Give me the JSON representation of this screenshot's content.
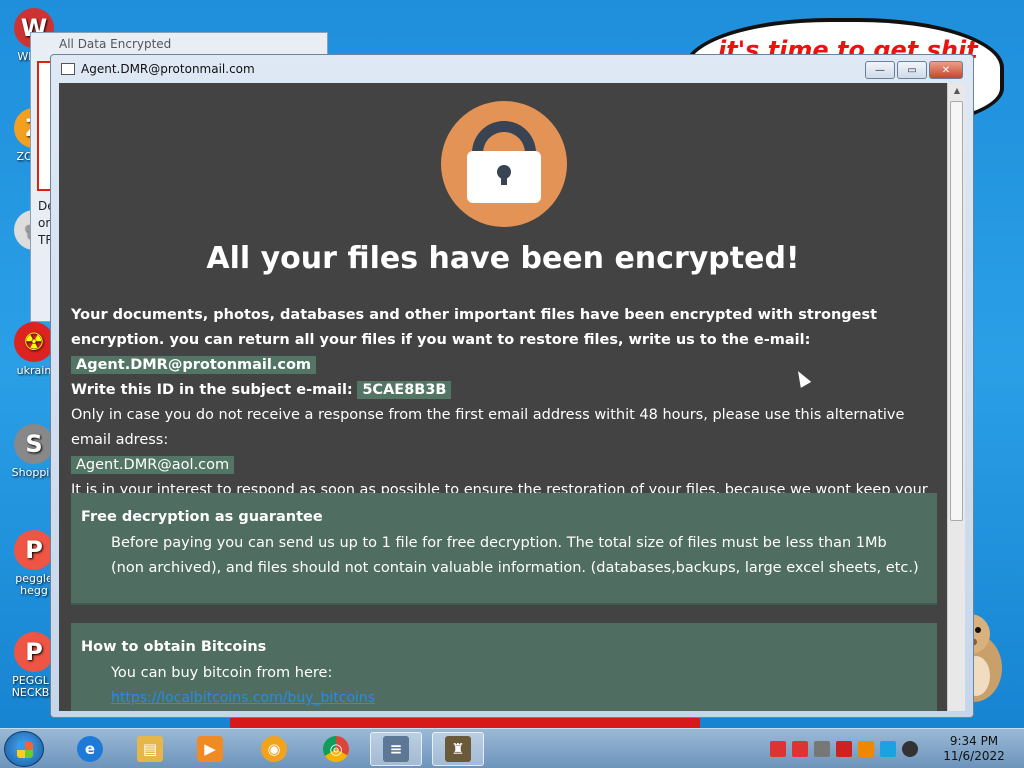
{
  "desktop": {
    "icons": [
      {
        "label": "WIN V",
        "glyph": "W",
        "color": "#c33"
      },
      {
        "label": "ZO DE",
        "glyph": "Z",
        "color": "#f3a020"
      },
      {
        "label": "",
        "glyph": "✿",
        "color": "#ddd"
      },
      {
        "label": "ukrain",
        "glyph": "☢",
        "color": "#d22"
      },
      {
        "label": "Shoppin",
        "glyph": "S",
        "color": "#888"
      },
      {
        "label": "peggle hegg",
        "glyph": "P",
        "color": "#e54"
      },
      {
        "label": "PEGGLE NECKBE",
        "glyph": "P",
        "color": "#e54"
      }
    ],
    "speech_text": "it's time to get shit"
  },
  "bg_window": {
    "title": "All Data Encrypted",
    "snippet": [
      "De",
      "or",
      "TR"
    ]
  },
  "window": {
    "title": "Agent.DMR@protonmail.com",
    "minimize": "—",
    "maximize": "▭",
    "close": "✕"
  },
  "note": {
    "headline": "All your files have been encrypted!",
    "line1": "Your documents, photos, databases and other important files have been encrypted with strongest encryption. you can return all your files if you want to restore files, write us to the e-mail:",
    "email_primary": "Agent.DMR@protonmail.com",
    "id_label": "Write this ID in the subject e-mail:",
    "id_value": "5CAE8B3B",
    "alt_text": "Only in case you do not receive a response from the first email address withit 48 hours, please use this alternative email adress:",
    "email_alt": "Agent.DMR@aol.com",
    "interest_text": "It is in your interest to respond as soon as possible to ensure the restoration of your files, because we wont keep your decryption keys at our server more than one week. The price depends on how fast you write to us.",
    "box1_title": "Free decryption as guarantee",
    "box1_text": "Before paying you can send us up to 1 file for free decryption. The total size of files must be less than 1Mb (non archived), and files should not contain valuable information. (databases,backups, large excel sheets, etc.)",
    "box2_title": "How to obtain Bitcoins",
    "box2_text": "You can buy bitcoin from here:",
    "box2_link": "https://localbitcoins.com/buy_bitcoins"
  },
  "taskbar": {
    "apps": [
      {
        "name": "ie",
        "glyph": "e",
        "color": "#1e7ad6"
      },
      {
        "name": "explorer",
        "glyph": "▤",
        "color": "#e5b748"
      },
      {
        "name": "media",
        "glyph": "▶",
        "color": "#f08a24"
      },
      {
        "name": "weibo",
        "glyph": "◉",
        "color": "#f3a21c"
      },
      {
        "name": "chrome",
        "glyph": "◎",
        "color": "#3a8f3a"
      },
      {
        "name": "notepad",
        "glyph": "≡",
        "color": "#5d7896"
      },
      {
        "name": "ransom",
        "glyph": "♜",
        "color": "#6b5a3a"
      }
    ],
    "time": "9:34 PM",
    "date": "11/6/2022"
  }
}
